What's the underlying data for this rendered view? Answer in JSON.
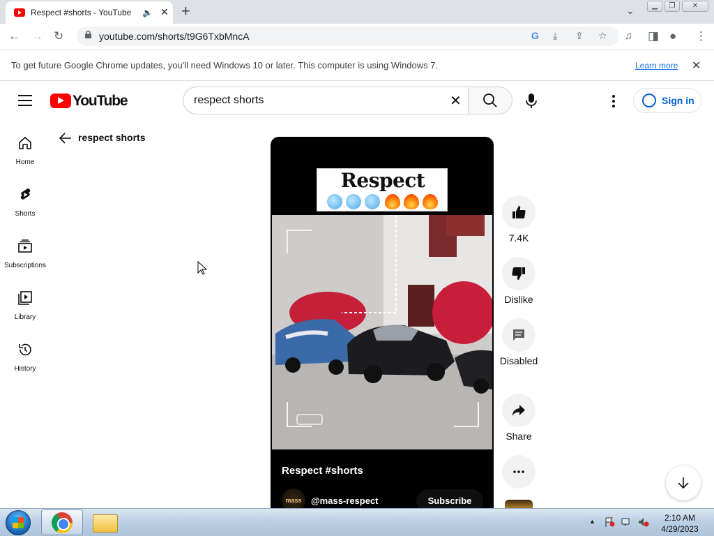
{
  "browser": {
    "tab_title": "Respect #shorts - YouTube",
    "url": "youtube.com/shorts/t9G6TxbMncA"
  },
  "infobar": {
    "text": "To get future Google Chrome updates, you'll need Windows 10 or later. This computer is using Windows 7.",
    "link": "Learn more"
  },
  "header": {
    "logo_text": "YouTube",
    "search_value": "respect shorts",
    "sign_in": "Sign in"
  },
  "sidebar": {
    "items": [
      {
        "label": "Home",
        "icon": "home-icon"
      },
      {
        "label": "Shorts",
        "icon": "shorts-icon"
      },
      {
        "label": "Subscriptions",
        "icon": "subscriptions-icon"
      },
      {
        "label": "Library",
        "icon": "library-icon"
      },
      {
        "label": "History",
        "icon": "history-icon"
      }
    ]
  },
  "back": {
    "label": "respect shorts"
  },
  "short": {
    "caption_word": "Respect",
    "video_title": "Respect #shorts",
    "channel_avatar": "mass",
    "channel_name": "@mass-respect",
    "subscribe": "Subscribe"
  },
  "actions": {
    "like_count": "7.4K",
    "dislike": "Dislike",
    "comments": "Disabled",
    "share": "Share"
  },
  "taskbar": {
    "time": "2:10 AM",
    "date": "4/29/2023"
  },
  "colors": {
    "youtube_red": "#ff0000",
    "link_blue": "#065fd4",
    "chrome_link": "#1a73e8"
  }
}
